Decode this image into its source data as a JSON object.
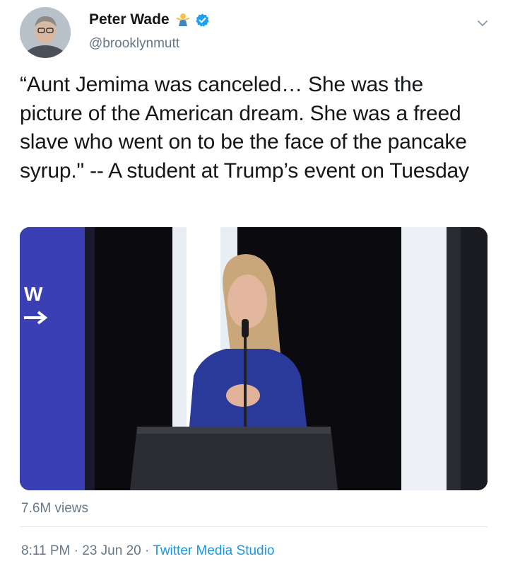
{
  "author": {
    "display_name": "Peter Wade",
    "handle": "@brooklynmutt",
    "badges": [
      "person-lifting-icon",
      "verified-icon"
    ]
  },
  "tweet": {
    "text": "“Aunt Jemima was canceled… She was the picture of the American dream. She was a freed slave who went on to be the face of the pancake syrup.\" -- A student at Trump’s event on Tuesday"
  },
  "media": {
    "type": "video",
    "description_icon": "video-thumbnail"
  },
  "stats": {
    "views": "7.6M views"
  },
  "meta": {
    "time": "8:11 PM",
    "sep1": " · ",
    "date": "23 Jun 20",
    "sep2": " · ",
    "source": "Twitter Media Studio"
  },
  "colors": {
    "link": "#1b95e0",
    "secondary_text": "#657786",
    "verified": "#1da1f2"
  }
}
